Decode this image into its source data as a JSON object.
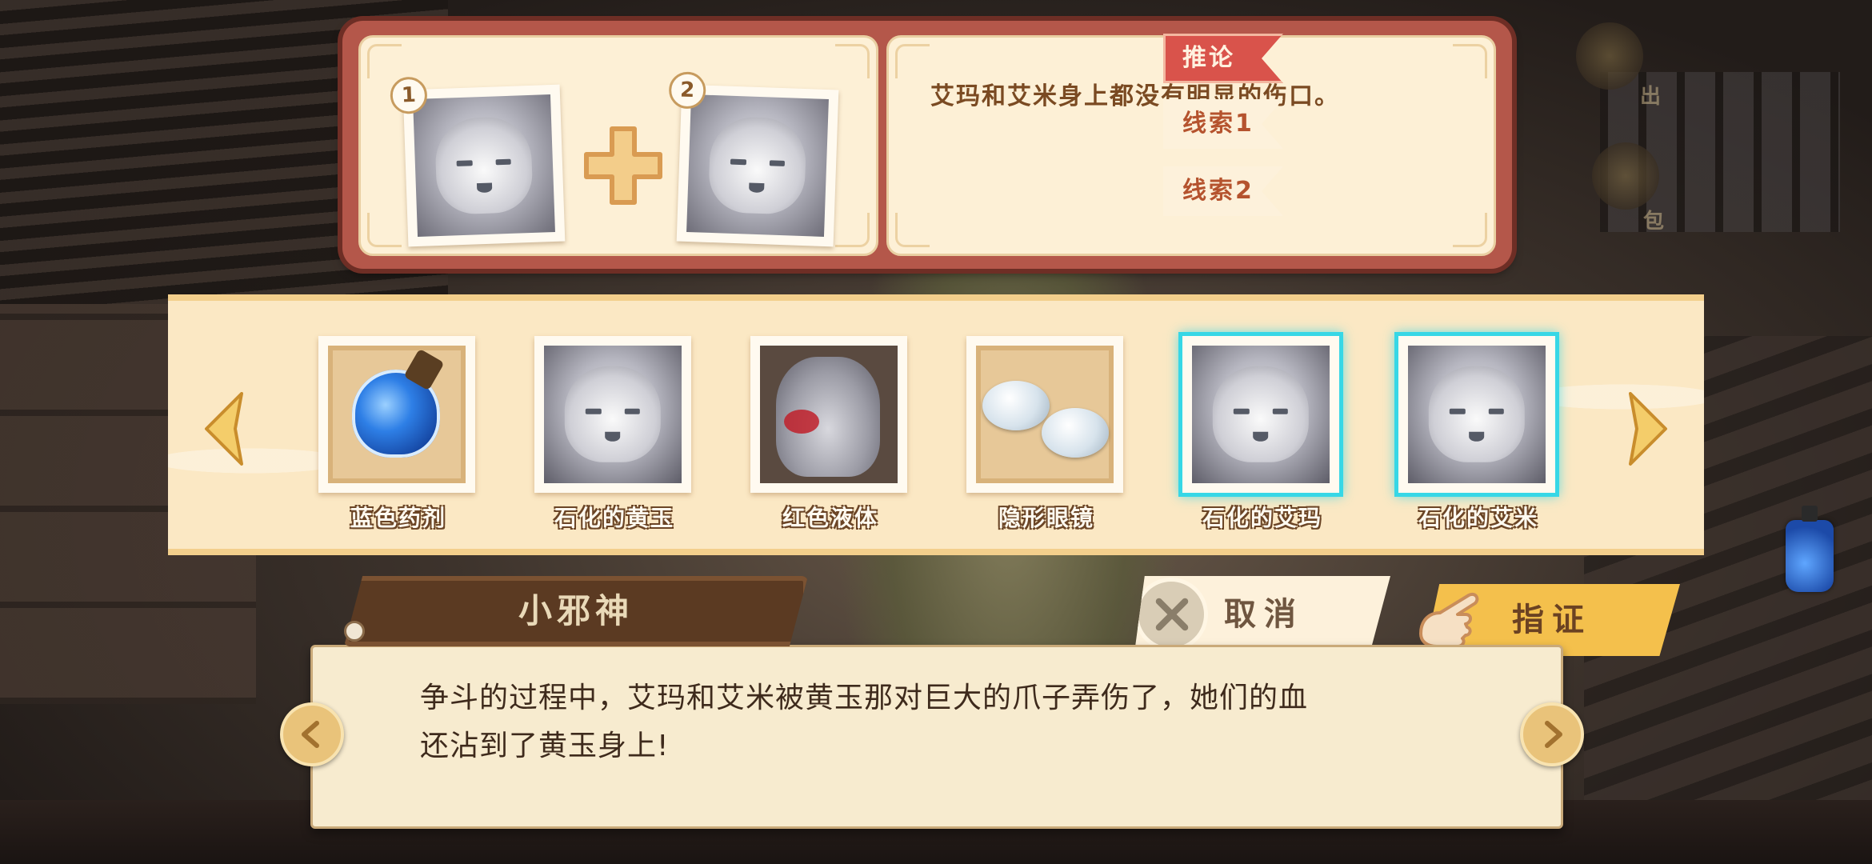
{
  "combination": {
    "slot1_number": "1",
    "slot2_number": "2",
    "description": "艾玛和艾米身上都没有明显的伤口。"
  },
  "tabs": [
    {
      "label": "推论",
      "active": true
    },
    {
      "label": "线索1",
      "active": false
    },
    {
      "label": "线索2",
      "active": false
    }
  ],
  "items": [
    {
      "name": "蓝色药剂",
      "icon": "blue-potion-icon",
      "selected": false
    },
    {
      "name": "石化的黄玉",
      "icon": "petrified-topaz-portrait",
      "selected": false
    },
    {
      "name": "红色液体",
      "icon": "red-liquid-hand-icon",
      "selected": false
    },
    {
      "name": "隐形眼镜",
      "icon": "contact-lens-icon",
      "selected": false
    },
    {
      "name": "石化的艾玛",
      "icon": "petrified-emma-portrait",
      "selected": true
    },
    {
      "name": "石化的艾米",
      "icon": "petrified-amy-portrait",
      "selected": true
    }
  ],
  "actions": {
    "cancel_label": "取消",
    "confirm_label": "指证"
  },
  "dialogue": {
    "speaker": "小邪神",
    "line1": "争斗的过程中，艾玛和艾米被黄玉那对巨大的爪子弄伤了，她们的血",
    "line2": "还沾到了黄玉身上!"
  },
  "background_labels": {
    "exit_fragment": "出",
    "bag_fragment": "包"
  },
  "colors": {
    "accent_red": "#d9534b",
    "select_cyan": "#37d7e6",
    "confirm_gold": "#f4c04c"
  }
}
